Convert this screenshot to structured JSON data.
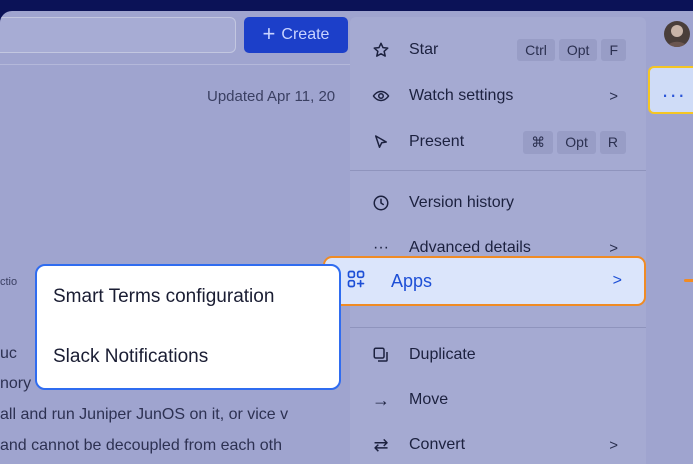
{
  "header": {
    "create_label": "Create",
    "updated_text": "Updated Apr 11, 20"
  },
  "content": {
    "side_label": "ctio",
    "lines": [
      "uc",
      "nory",
      "all and run Juniper JunOS on it, or vice v",
      " and cannot be decoupled from each oth"
    ]
  },
  "menu": {
    "star": {
      "label": "Star",
      "keys": [
        "Ctrl",
        "Opt",
        "F"
      ]
    },
    "watch": {
      "label": "Watch settings"
    },
    "present": {
      "label": "Present",
      "keys": [
        "⌘",
        "Opt",
        "R"
      ]
    },
    "version_history": {
      "label": "Version history"
    },
    "advanced": {
      "label": "Advanced details"
    },
    "apps": {
      "label": "Apps"
    },
    "duplicate": {
      "label": "Duplicate"
    },
    "move": {
      "label": "Move"
    },
    "convert": {
      "label": "Convert"
    }
  },
  "submenu": {
    "items": [
      "Smart Terms configuration",
      "Slack Notifications"
    ]
  },
  "more_button": {
    "label": "..."
  },
  "colors": {
    "accent": "#2f6cf0",
    "highlight_border": "#f08b24",
    "more_border": "#f5c623",
    "backdrop": "#0b1257"
  }
}
